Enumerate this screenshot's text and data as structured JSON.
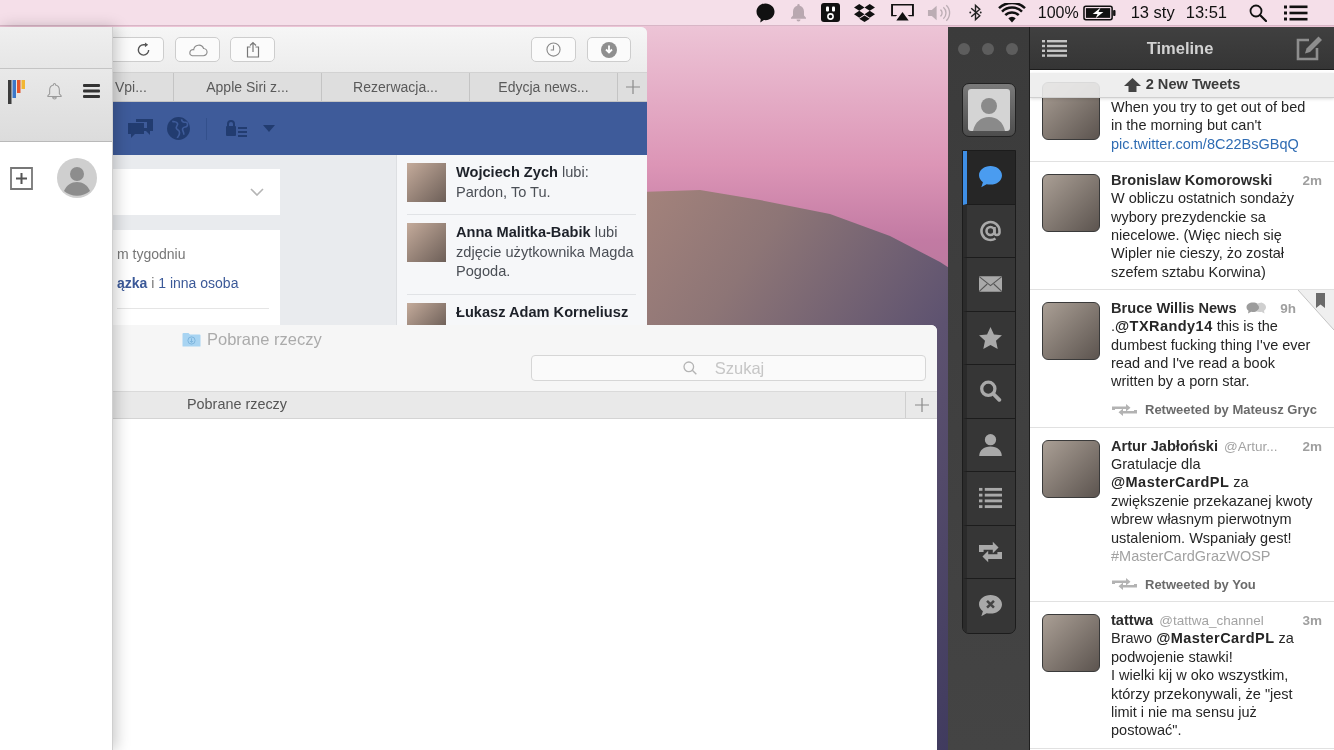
{
  "menu_bar": {
    "battery": "100%",
    "date": "13 sty",
    "time": "13:51"
  },
  "browser": {
    "tabs": [
      {
        "label": "Vpi...",
        "selected": false
      },
      {
        "label": "Apple Siri z...",
        "selected": false
      },
      {
        "label": "Rezerwacja...",
        "selected": false
      },
      {
        "label": "Edycja news...",
        "selected": false
      }
    ],
    "feed": {
      "activity_text": "m tygodniu",
      "likes": {
        "friend_link": "ązka",
        "joiner": "i",
        "others_link": "1 inna osoba"
      }
    },
    "ticker": [
      {
        "name": "Wojciech Zych",
        "text": "lubi: Pardon, To Tu."
      },
      {
        "name": "Anna Malitka-Babik",
        "text": "lubi zdjęcie użytkownika Magda Pogoda."
      },
      {
        "name": "Łukasz Adam Korneliusz"
      }
    ]
  },
  "finder": {
    "title": "Pobrane rzeczy",
    "search": {
      "placeholder": "Szukaj"
    },
    "tabs": [
      {
        "label": "Pobrane rzeczy",
        "selected": true
      }
    ]
  },
  "tweetbot": {
    "title": "Timeline",
    "nav": [
      {
        "kind": "timeline",
        "selected": true
      },
      {
        "kind": "mentions",
        "selected": false
      },
      {
        "kind": "messages",
        "selected": false
      },
      {
        "kind": "favorites",
        "selected": false
      },
      {
        "kind": "search",
        "selected": false
      },
      {
        "kind": "profile",
        "selected": false
      },
      {
        "kind": "lists",
        "selected": false
      },
      {
        "kind": "retweets",
        "selected": false
      },
      {
        "kind": "mutes",
        "selected": false
      }
    ],
    "new_tweets": "2 New Tweets",
    "tweets": [
      {
        "text": "When you try to get out of bed in the morning but can't",
        "link": "pic.twitter.com/8C22BsGBqQ",
        "conversation": false,
        "bookmarked": false
      },
      {
        "name": "Bronislaw Komorowski",
        "time": "2m",
        "text": "W obliczu ostatnich sondaży wybory prezydenckie sa niecelowe. (Więc niech się Wipler nie cieszy, żo został szefem sztabu Korwina)",
        "conversation": false,
        "bookmarked": false
      },
      {
        "name": "Bruce Willis News",
        "time": "9h",
        "text": ".**@TXRandy14** this is the dumbest fucking thing I've ever read and I've read a book written by a porn star.",
        "retweeted_by": "Retweeted by Mateusz Gryc",
        "conversation": true,
        "bookmarked": true
      },
      {
        "name": "Artur Jabłoński",
        "handle": "@Artur...",
        "time": "2m",
        "text": "Gratulacje dla **@MasterCardPL** za zwiększenie przekazanej kwoty wbrew własnym pierwotnym ustaleniom. Wspaniały gest!",
        "hashtag": "#MasterCardGrazWOSP",
        "retweeted_by": "Retweeted by You",
        "conversation": false,
        "bookmarked": false
      },
      {
        "name": "tattwa",
        "handle": "@tattwa_channel",
        "time": "3m",
        "text": "Brawo **@MasterCardPL** za podwojenie stawki!\nI wielki kij w oko wszystkim, którzy przekonywali, że \"jest limit i nie ma sensu już postować\".",
        "conversation": false,
        "bookmarked": false
      }
    ]
  }
}
